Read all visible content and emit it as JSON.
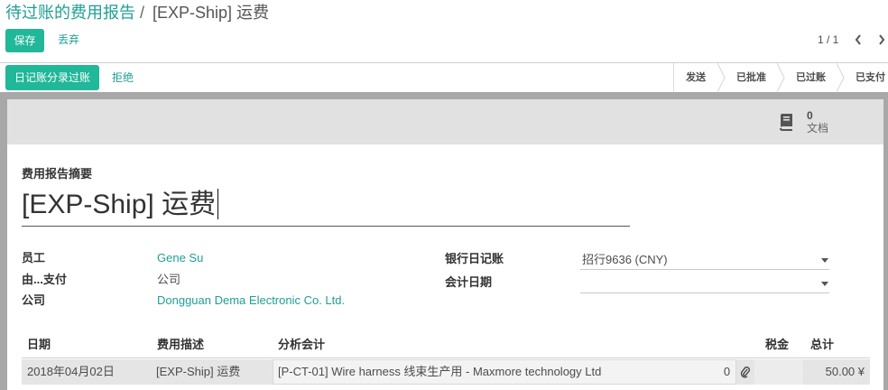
{
  "breadcrumb": {
    "parent": "待过账的费用报告",
    "separator": "/",
    "current": "[EXP-Ship] 运费"
  },
  "control_panel": {
    "save": "保存",
    "discard": "丢弃",
    "pager": "1 / 1",
    "pager_prev_icon": "chevron-left-icon",
    "pager_next_icon": "chevron-right-icon"
  },
  "header": {
    "post": "日记账分录过账",
    "refuse": "拒绝",
    "statusbar": [
      {
        "label": "发送"
      },
      {
        "label": "已批准"
      },
      {
        "label": "已过账"
      },
      {
        "label": "已支付"
      }
    ]
  },
  "smart_button": {
    "icon": "book-icon",
    "count": "0",
    "label": "文档"
  },
  "form": {
    "title_label": "费用报告摘要",
    "title_value": "[EXP-Ship] 运费",
    "left_fields": [
      {
        "label": "员工",
        "value": "Gene Su"
      },
      {
        "label": "由...支付",
        "value": "公司"
      },
      {
        "label": "公司",
        "value": "Dongguan Dema Electronic Co. Ltd."
      }
    ],
    "right_fields": [
      {
        "label": "银行日记账",
        "value": "招行9636 (CNY)",
        "icon": "chevron-down-icon"
      },
      {
        "label": "会计日期",
        "value": "",
        "icon": "chevron-down-icon"
      }
    ]
  },
  "expense_lines": {
    "columns": [
      "日期",
      "费用描述",
      "分析会计",
      "税金",
      "总计"
    ],
    "rows": [
      {
        "date": "2018年04月02日",
        "description": "[EXP-Ship] 运费",
        "analytic_account": "[P-CT-01] Wire harness 线束生产用 - Maxmore technology Ltd",
        "attachments": "0",
        "attachment_icon": "paperclip-icon",
        "tax": "",
        "total": "50.00 ¥"
      }
    ]
  },
  "colors": {
    "primary": "#21b799",
    "link": "#1f9f95",
    "text": "#4c4c4c",
    "frame": "#a8a8a8",
    "button_box": "#e1e1e1",
    "row": "#e5e5e5"
  }
}
